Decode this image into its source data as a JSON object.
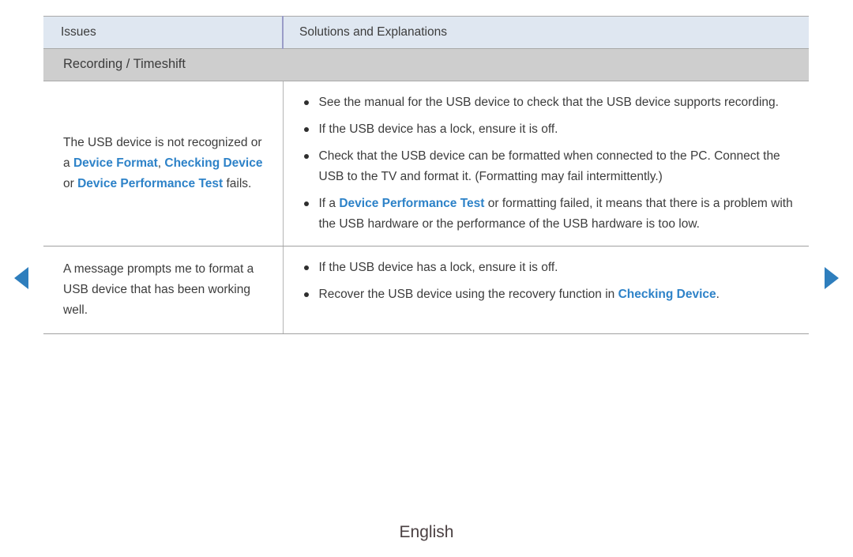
{
  "nav": {
    "prev_icon": "triangle-left-icon",
    "next_icon": "triangle-right-icon",
    "arrow_color": "#2e7ebd"
  },
  "table": {
    "headers": {
      "issues": "Issues",
      "solutions": "Solutions and Explanations"
    },
    "section_title": "Recording / Timeshift",
    "rows": [
      {
        "issue": {
          "segments": [
            {
              "text": "The USB device is not recognized or a ",
              "highlight": false
            },
            {
              "text": "Device Format",
              "highlight": true
            },
            {
              "text": ", ",
              "highlight": false
            },
            {
              "text": "Checking Device",
              "highlight": true
            },
            {
              "text": " or ",
              "highlight": false
            },
            {
              "text": "Device Performance Test",
              "highlight": true
            },
            {
              "text": " fails.",
              "highlight": false
            }
          ]
        },
        "bullets": [
          {
            "segments": [
              {
                "text": "See the manual for the USB device to check that the USB device supports recording.",
                "highlight": false
              }
            ]
          },
          {
            "segments": [
              {
                "text": "If the USB device has a lock, ensure it is off.",
                "highlight": false
              }
            ]
          },
          {
            "segments": [
              {
                "text": "Check that the USB device can be formatted when connected to the PC. Connect the USB to the TV and format it. (Formatting may fail intermittently.)",
                "highlight": false
              }
            ]
          },
          {
            "segments": [
              {
                "text": "If a ",
                "highlight": false
              },
              {
                "text": "Device Performance Test",
                "highlight": true
              },
              {
                "text": " or formatting failed, it means that there is a problem with the USB hardware or the performance of the USB hardware is too low.",
                "highlight": false
              }
            ]
          }
        ]
      },
      {
        "issue": {
          "segments": [
            {
              "text": "A message prompts me to format a USB device that has been working well.",
              "highlight": false
            }
          ]
        },
        "bullets": [
          {
            "segments": [
              {
                "text": "If the USB device has a lock, ensure it is off.",
                "highlight": false
              }
            ]
          },
          {
            "segments": [
              {
                "text": "Recover the USB device using the recovery function in ",
                "highlight": false
              },
              {
                "text": "Checking Device",
                "highlight": true
              },
              {
                "text": ".",
                "highlight": false
              }
            ]
          }
        ]
      }
    ]
  },
  "footer": {
    "language": "English"
  },
  "colors": {
    "header_bg": "#dfe7f1",
    "section_bg": "#cecece",
    "highlight": "#2d82c8",
    "divider_purple": "#9a9cc8",
    "text": "#3c3c3c"
  }
}
